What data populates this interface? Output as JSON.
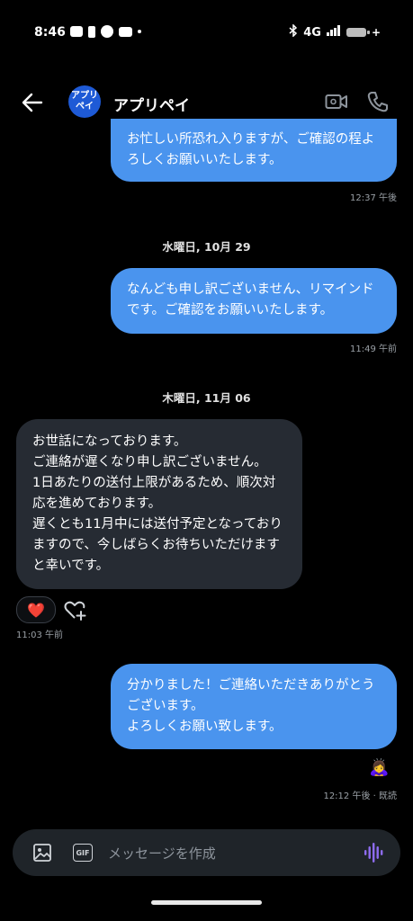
{
  "status_bar": {
    "time": "8:46",
    "network": "4G"
  },
  "header": {
    "avatar_text_line1": "アプリ",
    "avatar_text_line2": "ペイ",
    "title": "アプリペイ"
  },
  "messages": [
    {
      "direction": "out",
      "lines": [
        "お忙しい所恐れ入りますが、ご確認の程よ",
        "ろしくお願いいたします。"
      ],
      "time": "12:37 午後"
    },
    {
      "date_separator": "水曜日, 10月 29"
    },
    {
      "direction": "out",
      "lines": [
        "なんども申し訳ございません、リマインド",
        "です。ご確認をお願いいたします。"
      ],
      "time": "11:49 午前"
    },
    {
      "date_separator": "木曜日, 11月 06"
    },
    {
      "direction": "in",
      "lines": [
        "お世話になっております。",
        "ご連絡が遅くなり申し訳ございません。",
        "1日あたりの送付上限があるため、順次対",
        "応を進めております。",
        "遅くとも11月中には送付予定となっており",
        "ますので、今しばらくお待ちいただけます",
        "と幸いです。"
      ],
      "reaction": "❤️",
      "time": "11:03 午前"
    },
    {
      "direction": "out",
      "lines": [
        "分かりました！ご連絡いただきありがとう",
        "ございます。",
        "よろしくお願い致します。"
      ],
      "seen_emoji": "🙇‍♀️",
      "time": "12:12 午後 · 既読"
    }
  ],
  "composer": {
    "placeholder": "メッセージを作成",
    "gif_label": "GIF"
  },
  "colors": {
    "outgoing_bubble": "#4a94ee",
    "incoming_bubble": "#262b33",
    "voice_icon": "#8e6cf0"
  }
}
